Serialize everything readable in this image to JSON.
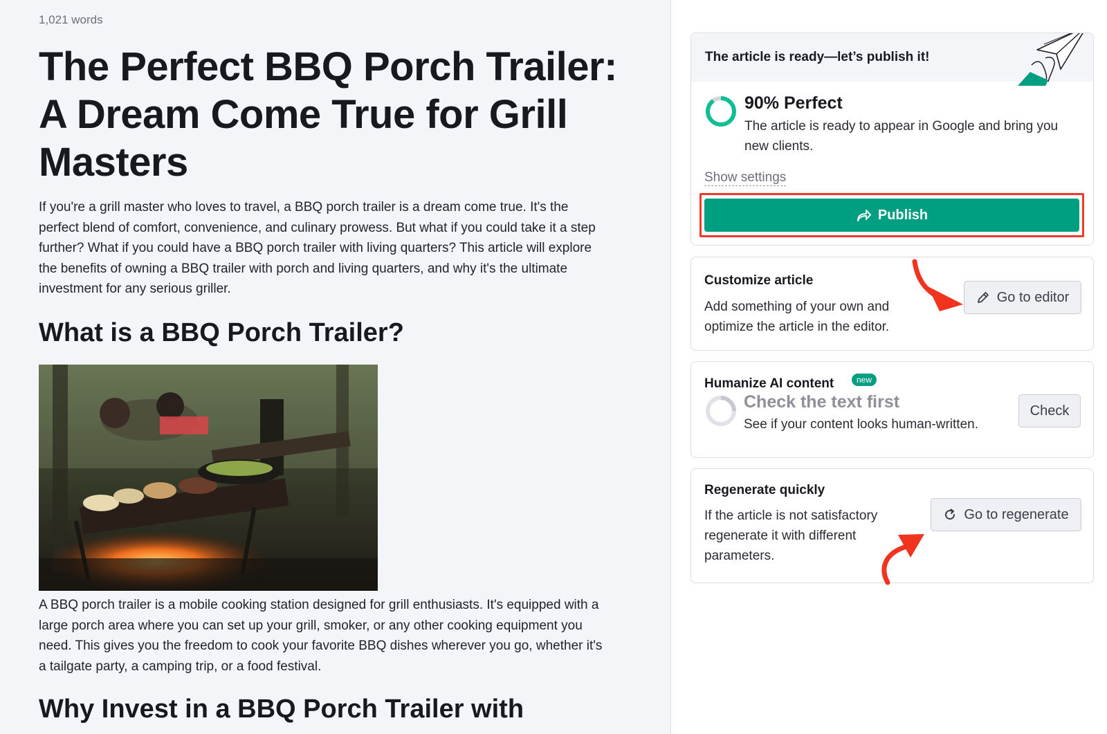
{
  "article": {
    "word_count": "1,021 words",
    "title": "The Perfect BBQ Porch Trailer: A Dream Come True for Grill Masters",
    "intro": "If you're a grill master who loves to travel, a BBQ porch trailer is a dream come true. It's the perfect blend of comfort, convenience, and culinary prowess. But what if you could take it a step further? What if you could have a BBQ porch trailer with living quarters? This article will explore the benefits of owning a BBQ trailer with porch and living quarters, and why it's the ultimate investment for any serious griller.",
    "section1_heading": "What is a BBQ Porch Trailer?",
    "section1_text": "A BBQ porch trailer is a mobile cooking station designed for grill enthusiasts. It's equipped with a large porch area where you can set up your grill, smoker, or any other cooking equipment you need. This gives you the freedom to cook your favorite BBQ dishes wherever you go, whether it's a tailgate party, a camping trip, or a food festival.",
    "section2_heading": "Why Invest in a BBQ Porch Trailer with"
  },
  "panel": {
    "ready": {
      "title": "The article is ready—let’s publish it!",
      "score_label": "90% Perfect",
      "score_value": 0.9,
      "description": "The article is ready to appear in Google and bring you new clients.",
      "show_settings": "Show settings",
      "publish_label": "Publish"
    },
    "customize": {
      "title": "Customize article",
      "description": "Add something of your own and optimize the article in the editor.",
      "button_label": "Go to editor"
    },
    "humanize": {
      "title": "Humanize AI content",
      "badge": "new",
      "subtitle": "Check the text first",
      "description": "See if your content looks human-written.",
      "button_label": "Check"
    },
    "regenerate": {
      "title": "Regenerate quickly",
      "description": "If the article is not satisfactory regenerate it with different parameters.",
      "button_label": "Go to regenerate"
    }
  },
  "colors": {
    "accent": "#009f81",
    "highlight": "#ee3a2a",
    "article_bg": "#f4f5f9"
  },
  "icons": [
    "paper-plane-icon",
    "share-arrow-icon",
    "pencil-icon",
    "refresh-icon"
  ]
}
